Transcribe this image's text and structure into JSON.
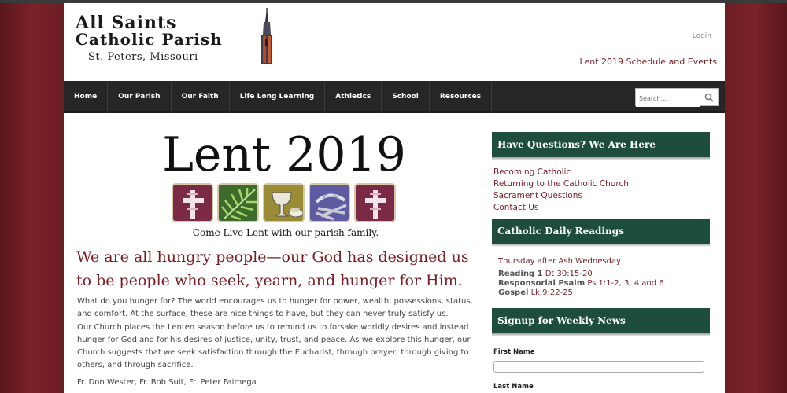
{
  "header": {
    "logo_line1": "All Saints",
    "logo_line2": "Catholic Parish",
    "logo_line3": "St. Peters, Missouri",
    "login": "Login",
    "lent_link": "Lent 2019 Schedule and Events"
  },
  "nav": {
    "items": [
      "Home",
      "Our Parish",
      "Our Faith",
      "Life Long Learning",
      "Athletics",
      "School",
      "Resources"
    ],
    "search_placeholder": "Search..."
  },
  "main": {
    "title": "Lent 2019",
    "tile_caption": "Come Live Lent with our parish family.",
    "headline": "We are all hungry people—our God has designed us to be people who seek, yearn, and hunger for Him.",
    "para1": "What do you hunger for? The world encourages us to hunger for power, wealth, possessions, status, and comfort. At the surface, these are nice things to have, but they can never truly satisfy us.",
    "para2": "Our Church places the Lenten season before us to remind us to forsake worldly desires and instead hunger for God and for his desires of justice, unity, trust, and peace. As we explore this hunger, our Church suggests that we seek satisfaction through the Eucharist, through prayer, through giving to others, and through sacrifice.",
    "signature": "Fr. Don Wester, Fr. Bob Suit, Fr. Peter Faimega"
  },
  "sidebar": {
    "questions_title": "Have Questions? We Are Here",
    "questions_links": [
      "Becoming Catholic",
      "Returning to the Catholic Church",
      "Sacrament Questions",
      "Contact Us"
    ],
    "readings_title": "Catholic Daily Readings",
    "readings_day": "Thursday after Ash Wednesday",
    "readings": [
      {
        "label": "Reading 1",
        "ref": "Dt 30:15-20"
      },
      {
        "label": "Responsorial Psalm",
        "ref": "Ps 1:1-2, 3, 4 and 6"
      },
      {
        "label": "Gospel",
        "ref": "Lk 9:22-25"
      }
    ],
    "signup_title": "Signup for Weekly News",
    "first_name_label": "First Name",
    "last_name_label": "Last Name"
  },
  "colors": {
    "brand_maroon": "#7a1c22",
    "sidebar_green": "#1e4e3b",
    "nav_dark": "#262626"
  }
}
